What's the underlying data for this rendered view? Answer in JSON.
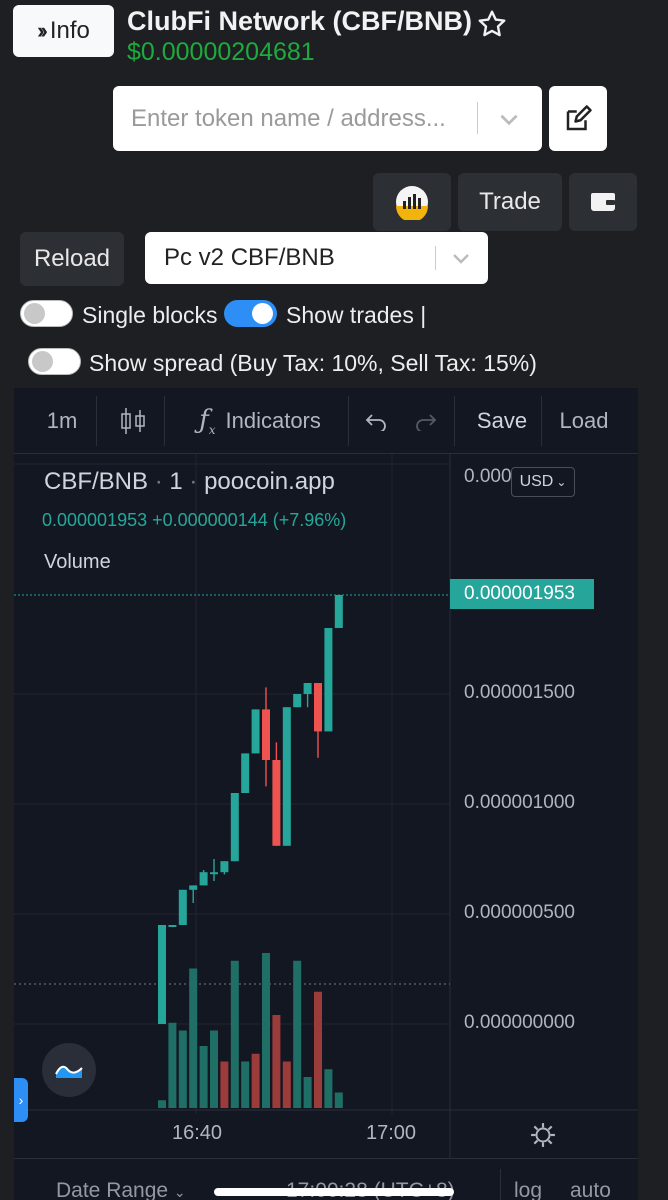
{
  "header": {
    "info_label": "Info",
    "title": "ClubFi Network (CBF/BNB)",
    "price": "$0.00000204681"
  },
  "search": {
    "placeholder": "Enter token name / address..."
  },
  "buttons": {
    "trade": "Trade",
    "reload": "Reload"
  },
  "pair_select": {
    "value": "Pc v2 CBF/BNB"
  },
  "toggles": {
    "single_blocks": {
      "label": "Single blocks",
      "on": false
    },
    "show_trades": {
      "label": "Show trades |",
      "on": true
    },
    "show_spread": {
      "label": "Show spread (Buy Tax: 10%, Sell Tax: 15%)",
      "on": false
    }
  },
  "chart_toolbar": {
    "interval": "1m",
    "indicators": "Indicators",
    "save": "Save",
    "load": "Load"
  },
  "chart_legend": {
    "symbol": "CBF/BNB",
    "interval": "1",
    "source": "poocoin.app",
    "ohlc": "0.000001953 +0.000000144 (+7.96%)",
    "volume_label": "Volume",
    "currency": "USD",
    "axis_top_partial": "0.000",
    "current_price": "0.000001953"
  },
  "bottom_bar": {
    "date_range": "Date Range",
    "time": "17:00:28 (UTC+8)",
    "log": "log",
    "auto": "auto"
  },
  "colors": {
    "up": "#26a69a",
    "down": "#ef5350",
    "price_green": "#1eaa3c",
    "accent": "#2d8ef5"
  },
  "chart_data": {
    "type": "candlestick",
    "y_ticks": [
      "0.000000000",
      "0.000000500",
      "0.000001000",
      "0.000001500"
    ],
    "x_ticks": [
      "16:40",
      "17:00"
    ],
    "ylim": [
      0,
      1.95e-06
    ],
    "xlim_minutes": [
      0,
      23
    ],
    "candles": [
      {
        "t": 0,
        "o": 0.0,
        "h": 4.5e-07,
        "l": 0.0,
        "c": 4.5e-07
      },
      {
        "t": 1,
        "o": 4.5e-07,
        "h": 4.5e-07,
        "l": 4.4e-07,
        "c": 4.5e-07
      },
      {
        "t": 2,
        "o": 4.5e-07,
        "h": 6.1e-07,
        "l": 4.5e-07,
        "c": 6.1e-07
      },
      {
        "t": 3,
        "o": 6.1e-07,
        "h": 6.3e-07,
        "l": 5.5e-07,
        "c": 6.3e-07
      },
      {
        "t": 4,
        "o": 6.3e-07,
        "h": 7e-07,
        "l": 6.3e-07,
        "c": 6.9e-07
      },
      {
        "t": 5,
        "o": 6.9e-07,
        "h": 7.5e-07,
        "l": 6.5e-07,
        "c": 6.9e-07
      },
      {
        "t": 6,
        "o": 6.9e-07,
        "h": 7.4e-07,
        "l": 6.8e-07,
        "c": 7.4e-07
      },
      {
        "t": 7,
        "o": 7.4e-07,
        "h": 1.05e-06,
        "l": 7.4e-07,
        "c": 1.05e-06
      },
      {
        "t": 8,
        "o": 1.05e-06,
        "h": 1.23e-06,
        "l": 1.05e-06,
        "c": 1.23e-06
      },
      {
        "t": 9,
        "o": 1.23e-06,
        "h": 1.43e-06,
        "l": 1.23e-06,
        "c": 1.43e-06
      },
      {
        "t": 10,
        "o": 1.43e-06,
        "h": 1.53e-06,
        "l": 1.08e-06,
        "c": 1.2e-06
      },
      {
        "t": 11,
        "o": 1.2e-06,
        "h": 1.28e-06,
        "l": 8.1e-07,
        "c": 8.1e-07
      },
      {
        "t": 12,
        "o": 8.1e-07,
        "h": 1.44e-06,
        "l": 8.1e-07,
        "c": 1.44e-06
      },
      {
        "t": 13,
        "o": 1.44e-06,
        "h": 1.5e-06,
        "l": 1.44e-06,
        "c": 1.5e-06
      },
      {
        "t": 14,
        "o": 1.5e-06,
        "h": 1.55e-06,
        "l": 1.44e-06,
        "c": 1.55e-06
      },
      {
        "t": 15,
        "o": 1.55e-06,
        "h": 1.55e-06,
        "l": 1.21e-06,
        "c": 1.33e-06
      },
      {
        "t": 16,
        "o": 1.33e-06,
        "h": 1.8e-06,
        "l": 1.33e-06,
        "c": 1.8e-06
      },
      {
        "t": 17,
        "o": 1.8e-06,
        "h": 1.95e-06,
        "l": 1.8e-06,
        "c": 1.95e-06
      }
    ],
    "volume_relative": [
      0.05,
      0.55,
      0.5,
      0.9,
      0.4,
      0.5,
      0.3,
      0.95,
      0.3,
      0.35,
      1.0,
      0.6,
      0.3,
      0.95,
      0.2,
      0.75,
      0.25,
      0.1
    ],
    "volume_direction": [
      "up",
      "up",
      "up",
      "up",
      "up",
      "up",
      "down",
      "up",
      "up",
      "down",
      "up",
      "down",
      "down",
      "up",
      "up",
      "down",
      "up",
      "up"
    ]
  }
}
